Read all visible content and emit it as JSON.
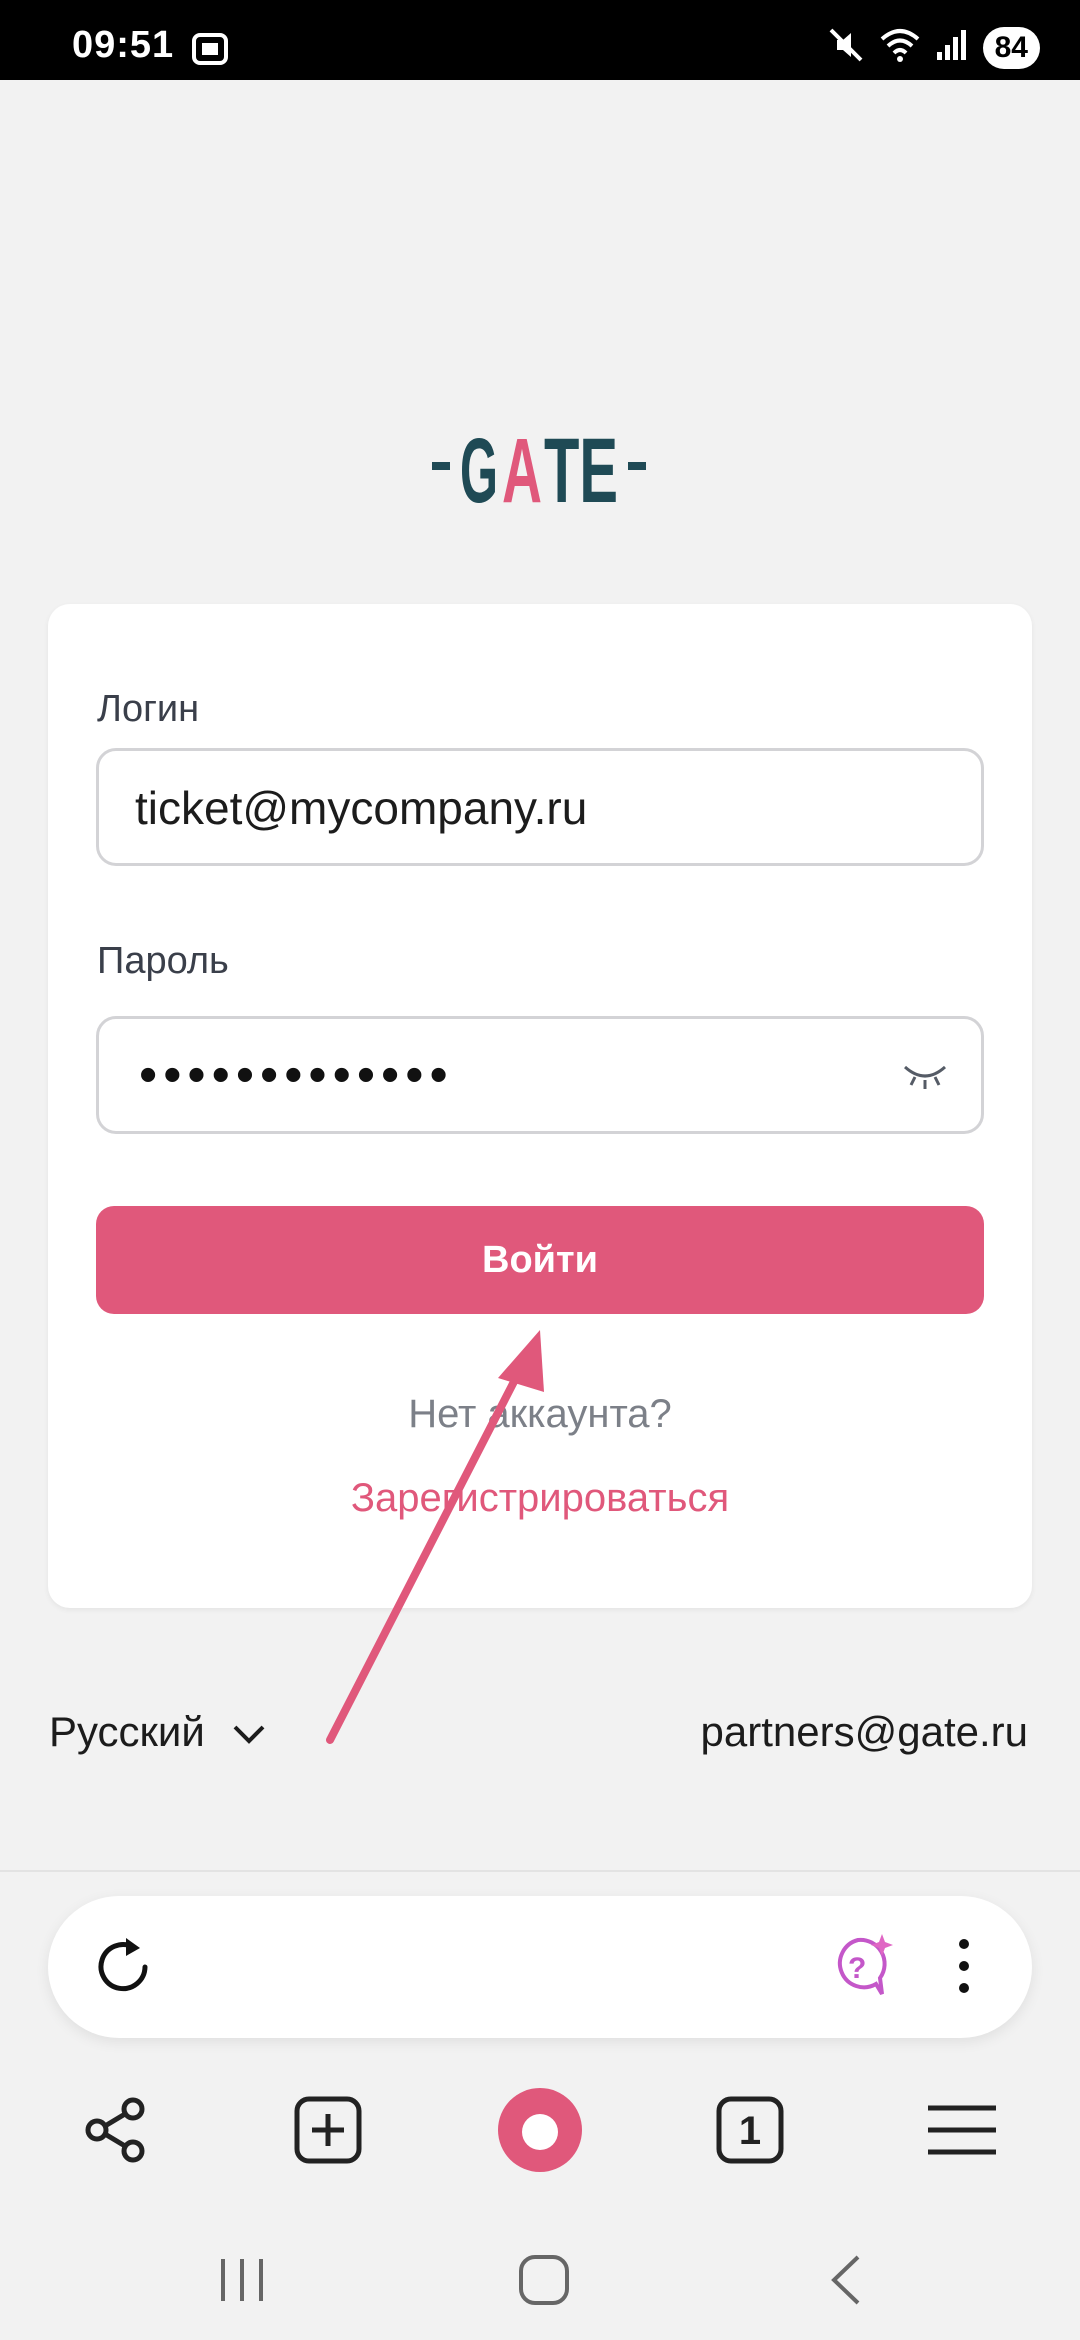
{
  "status_bar": {
    "time": "09:51",
    "battery": "84"
  },
  "logo": {
    "text": "GATE",
    "dark_color": "#1f4a55",
    "accent_color": "#e0587b"
  },
  "form": {
    "login_label": "Логин",
    "login_value": "ticket@mycompany.ru",
    "password_label": "Пароль",
    "password_masked": "•••••••••••••",
    "submit_label": "Войти",
    "no_account_text": "Нет аккаунта?",
    "register_link": "Зарегистрироваться"
  },
  "footer": {
    "language": "Русский",
    "contact_email": "partners@gate.ru"
  },
  "browser": {
    "tab_count": "1"
  },
  "colors": {
    "accent": "#e0587b",
    "background": "#f2f2f2",
    "card": "#ffffff"
  }
}
